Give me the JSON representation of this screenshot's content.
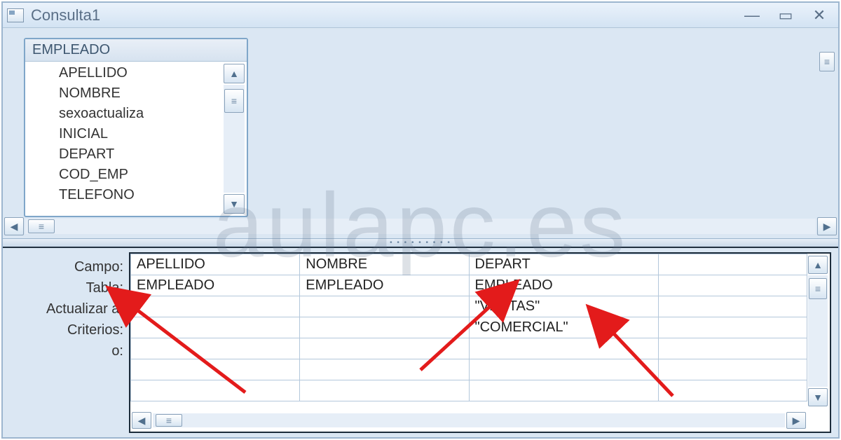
{
  "window": {
    "title": "Consulta1"
  },
  "watermark": "aulapc.es",
  "table_box": {
    "name": "EMPLEADO",
    "fields": [
      "APELLIDO",
      "NOMBRE",
      "sexoactualiza",
      "INICIAL",
      "DEPART",
      "COD_EMP",
      "TELEFONO"
    ]
  },
  "grid": {
    "row_labels": [
      "Campo:",
      "Tabla:",
      "Actualizar a:",
      "Criterios:",
      "o:"
    ],
    "columns": [
      {
        "campo": "APELLIDO",
        "tabla": "EMPLEADO",
        "actualizar": "",
        "criterios": "",
        "o": ""
      },
      {
        "campo": "NOMBRE",
        "tabla": "EMPLEADO",
        "actualizar": "",
        "criterios": "",
        "o": ""
      },
      {
        "campo": "DEPART",
        "tabla": "EMPLEADO",
        "actualizar": "\"VENTAS\"",
        "criterios": "\"COMERCIAL\"",
        "o": ""
      },
      {
        "campo": "",
        "tabla": "",
        "actualizar": "",
        "criterios": "",
        "o": ""
      }
    ]
  }
}
